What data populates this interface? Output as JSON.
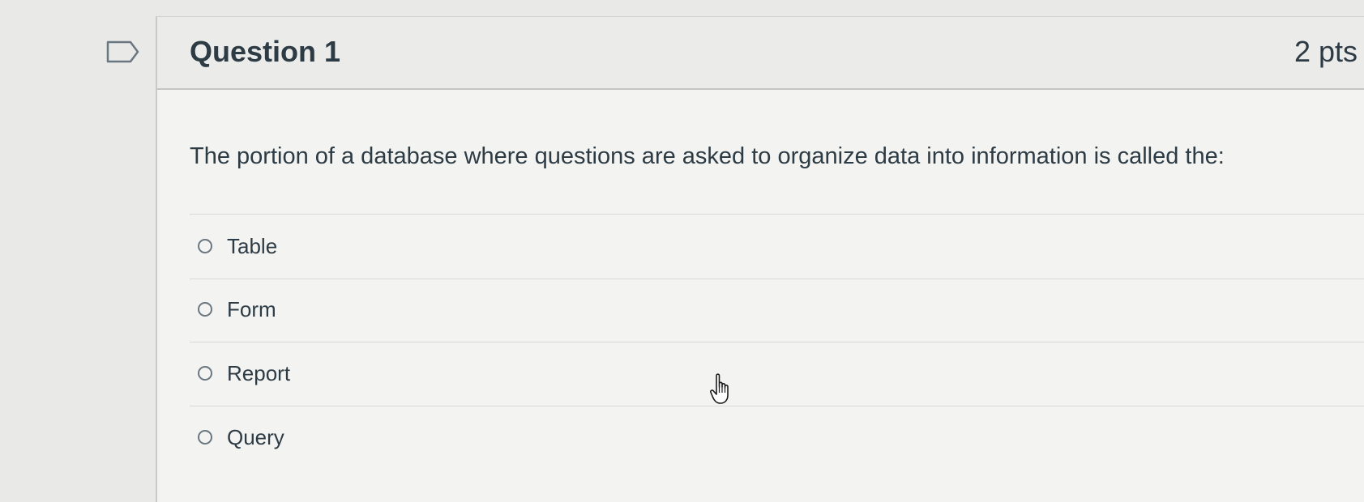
{
  "question": {
    "title": "Question 1",
    "points": "2 pts",
    "text": "The portion of a database where questions are asked to organize data into information is called the:",
    "flag_icon": "flag-icon",
    "answers": [
      {
        "label": "Table",
        "selected": false
      },
      {
        "label": "Form",
        "selected": false
      },
      {
        "label": "Report",
        "selected": false
      },
      {
        "label": "Query",
        "selected": false
      }
    ]
  },
  "cursor_icon": "hand-pointer-icon",
  "colors": {
    "background": "#e9e9e7",
    "card": "#f3f3f1",
    "header": "#ebebea",
    "text": "#2d3b45"
  }
}
